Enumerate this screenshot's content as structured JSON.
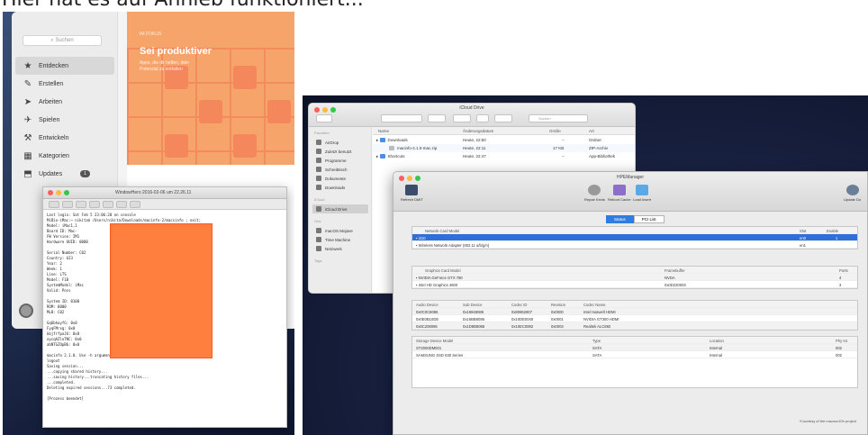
{
  "caption": "Hier hat es auf Anhieb funktioniert...",
  "left_screenshot": {
    "appstore": {
      "search_placeholder": "Suchen",
      "sidebar": [
        {
          "label": "Entdecken",
          "icon": "star-icon",
          "selected": true
        },
        {
          "label": "Erstellen",
          "icon": "brush-icon"
        },
        {
          "label": "Arbeiten",
          "icon": "paperplane-icon"
        },
        {
          "label": "Spielen",
          "icon": "rocket-icon"
        },
        {
          "label": "Entwickeln",
          "icon": "hammer-icon"
        },
        {
          "label": "Kategorien",
          "icon": "grid-icon"
        },
        {
          "label": "Updates",
          "icon": "updates-icon",
          "badge": "1"
        }
      ],
      "hero": {
        "kicker": "IM FOKUS",
        "title": "Sei produktiver",
        "subtitle": "Apps, die dir helfen, dein Potenzial zu entfalten"
      }
    },
    "terminal": {
      "title": "WindowHero 2016-02-06 um 22.26.11",
      "lines": [
        "Last login: Sat Feb  5 23:06:20 on console",
        "MiBio-iMac:~ nikita$ /Users/nikita/Downloads/macinfo-2/macsinfo ; exit;",
        "     Model: iMac1,1",
        "  Board ID: Mac-",
        "FW Version: IM1",
        "Hardware UUID: 0000",
        "",
        "Serial Number: C02",
        "   Country: UJ3",
        "      Year: 2",
        "      Week: 1",
        "      Line: LTS",
        "     Model: F1B",
        "SystemModel: iMac",
        "      Valid: Poss",
        "",
        "  System ID: 0100",
        "        ROM: 0000",
        "        MLB: C02",
        "",
        "  Gq6bhayfG: 0x0",
        "   FyqFMrxg: 0x0",
        "   kbjfrfpoJU: 0x0",
        "  oycqAZloTNC: 0x0",
        "  abNTGZOpB6: 0x0",
        "",
        "macinfo 2.1.0. Use -h argument to see usage options.",
        "logout",
        "Saving session...",
        "...copying shared history...",
        "...saving history...truncating history files...",
        "...completed.",
        "Deleting expired sessions...73 completed.",
        "",
        "[Prozess beendet]"
      ]
    }
  },
  "right_screenshot": {
    "finder": {
      "title": "iCloud Drive",
      "search_placeholder": "Suchen",
      "sidebar_sections": [
        {
          "title": "Favoriten",
          "items": [
            "AirDrop",
            "Zuletzt benutzt",
            "Programme",
            "Schreibtisch",
            "Dokumente",
            "Downloads"
          ]
        },
        {
          "title": "iCloud",
          "items": [
            "iCloud Drive"
          ]
        },
        {
          "title": "Orte",
          "items": [
            "macOS Mojave",
            "Time Machine",
            "Netzwerk"
          ]
        },
        {
          "title": "Tags",
          "items": []
        }
      ],
      "columns": [
        "Name",
        "Änderungsdatum",
        "Größe",
        "Art"
      ],
      "rows": [
        {
          "name": "Downloads",
          "date": "Heute, 22:50",
          "size": "--",
          "kind": "Ordner"
        },
        {
          "name": "macinfo-2.1.0-mac.zip",
          "date": "Heute, 22:11",
          "size": "17 KB",
          "kind": "ZIP-Archiv"
        },
        {
          "name": "Shortcuts",
          "date": "Heute, 22:47",
          "size": "--",
          "kind": "App-Bibliothek"
        }
      ]
    },
    "hwmanager": {
      "title": "HPEManager",
      "toolbar": [
        {
          "label": "Refresh DMIT",
          "icon": "monitor-icon"
        },
        {
          "label": "Repair Kexts",
          "icon": "gear-icon"
        },
        {
          "label": "Reboot Cache",
          "icon": "purple-box-icon"
        },
        {
          "label": "Load Insert",
          "icon": "blue-box-icon"
        },
        {
          "label": "Update Do",
          "icon": "globe-icon"
        }
      ],
      "tabs": [
        "Status",
        "PCI List"
      ],
      "active_tab": "Status",
      "network": {
        "columns": [
          "Network Card Model",
          "Slot",
          "Enable"
        ],
        "rows": [
          {
            "model": "i210",
            "slot": "en0",
            "enable": "1",
            "selected": true
          },
          {
            "model": "Wireless Network Adapter (802.11 a/b/g/n)",
            "slot": "en1",
            "enable": ""
          }
        ]
      },
      "graphics": {
        "columns": [
          "Graphics Card Model",
          "Framebuffer",
          "Ports"
        ],
        "rows": [
          {
            "model": "NVIDIA GeForce GTX 780",
            "fb": "NVDA",
            "ports": "4"
          },
          {
            "model": "Intel HD Graphics 4600",
            "fb": "0x0D220003",
            "ports": "3"
          }
        ]
      },
      "audio": {
        "columns": [
          "Audio Device",
          "Sub Device",
          "Codec ID",
          "Revision",
          "Codec Name"
        ],
        "rows": [
          {
            "dev": "0x0C0C8086",
            "sub": "0x19848086",
            "codec": "0x80862807",
            "rev": "0x0000",
            "name": "Intel Haswell HDMI"
          },
          {
            "dev": "0x0E0B10DE",
            "sub": "0x16BB8086",
            "codec": "0x10DE0040",
            "rev": "0x0001",
            "name": "NVIDIA GT300 HDMI"
          },
          {
            "dev": "0x8C208086",
            "sub": "0x1D8B8086",
            "codec": "0x10EC0892",
            "rev": "0x0003",
            "name": "Realtek ALC892"
          }
        ]
      },
      "storage": {
        "columns": [
          "Storage Device Model",
          "Type",
          "Location",
          "Phy Int"
        ],
        "rows": [
          {
            "model": "ST2000DM001",
            "type": "SATA",
            "loc": "Internal",
            "phy": "002"
          },
          {
            "model": "SAMSUNG SSD 830 Series",
            "type": "SATA",
            "loc": "Internal",
            "phy": "002"
          }
        ]
      },
      "footer": "*Courtesy of the macosx10h project"
    }
  }
}
